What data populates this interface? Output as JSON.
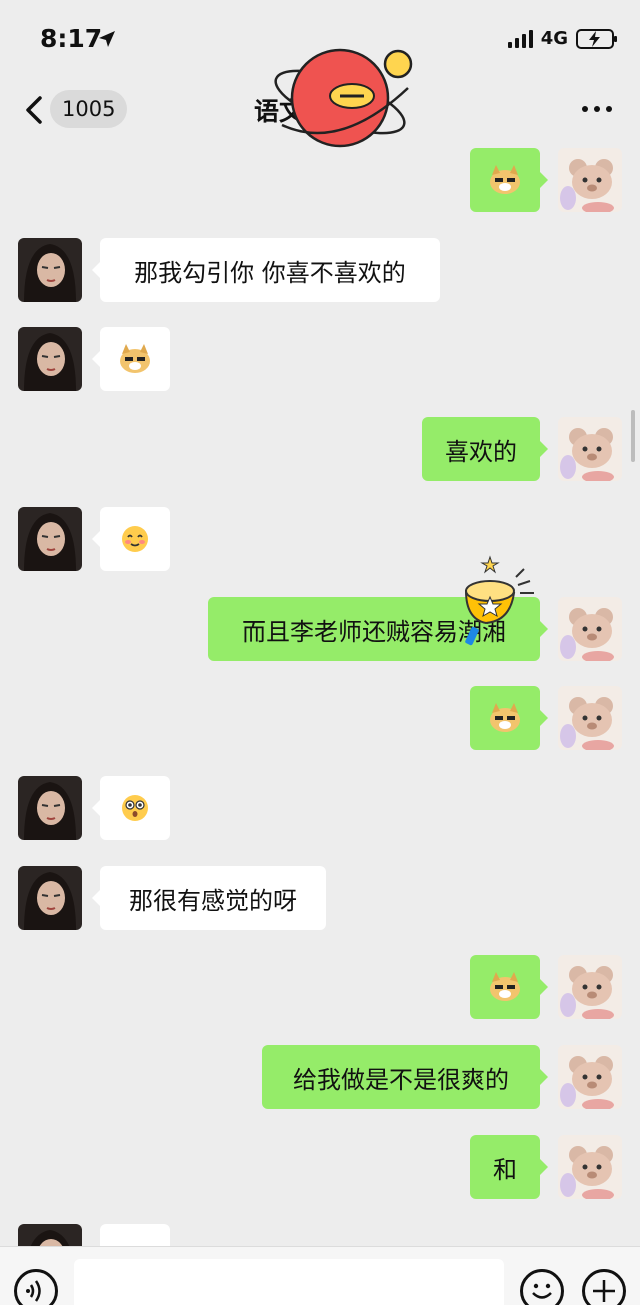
{
  "status_bar": {
    "time": "8:17",
    "network": "4G"
  },
  "nav": {
    "unread_count": "1005",
    "title": "语文"
  },
  "messages": [
    {
      "side": "right",
      "type": "sticker",
      "sticker": "doge-sticker"
    },
    {
      "side": "left",
      "type": "text",
      "text": "那我勾引你 你喜不喜欢的"
    },
    {
      "side": "left",
      "type": "sticker",
      "sticker": "doge-sticker"
    },
    {
      "side": "right",
      "type": "text",
      "text": "喜欢的"
    },
    {
      "side": "left",
      "type": "sticker",
      "sticker": "blush-emoji"
    },
    {
      "side": "right",
      "type": "text",
      "text": "而且李老师还贼容易潮湘"
    },
    {
      "side": "right",
      "type": "sticker",
      "sticker": "doge-sticker"
    },
    {
      "side": "left",
      "type": "sticker",
      "sticker": "surprised-emoji"
    },
    {
      "side": "left",
      "type": "text",
      "text": "那很有感觉的呀"
    },
    {
      "side": "right",
      "type": "sticker",
      "sticker": "doge-sticker"
    },
    {
      "side": "right",
      "type": "text",
      "text": "给我做是不是很爽的"
    },
    {
      "side": "right",
      "type": "text",
      "text": "和"
    },
    {
      "side": "left",
      "type": "sticker",
      "sticker": "partial"
    }
  ],
  "colors": {
    "background": "#ededed",
    "own_bubble": "#95ec69",
    "other_bubble": "#ffffff"
  },
  "icons": [
    "back-chevron-icon",
    "more-icon",
    "voice-icon",
    "emoji-icon",
    "plus-icon"
  ]
}
